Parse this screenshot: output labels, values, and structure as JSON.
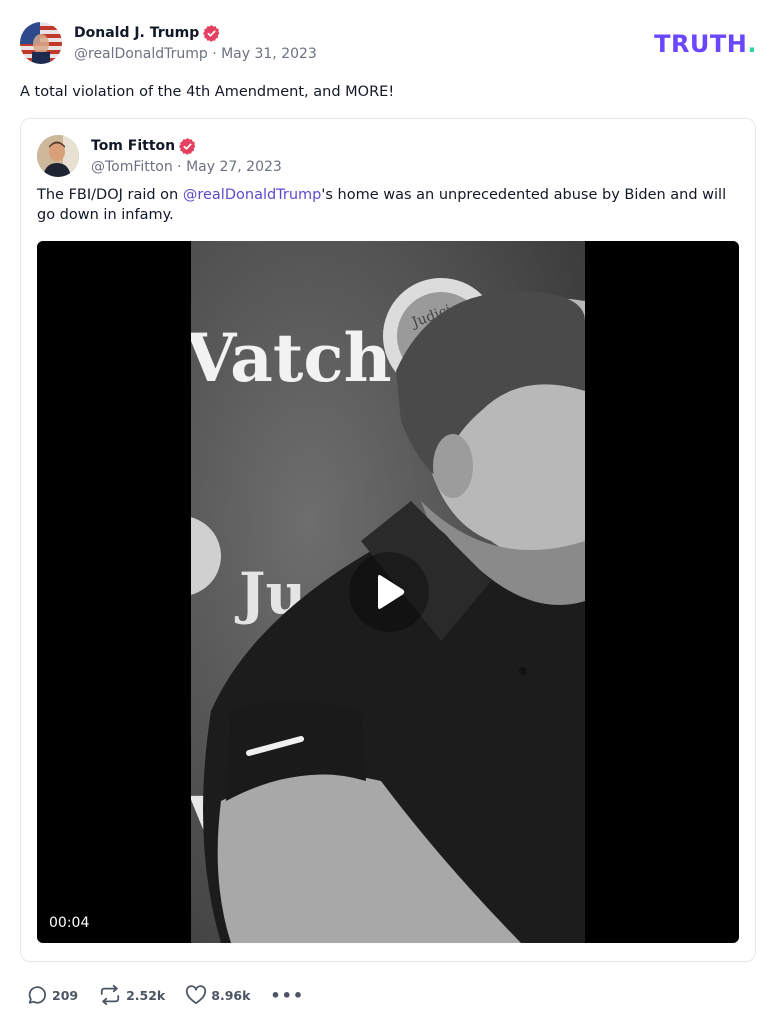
{
  "post": {
    "author_name": "Donald J. Trump",
    "handle_date": "@realDonaldTrump · May 31, 2023",
    "text": "A total violation of the 4th Amendment, and MORE!",
    "logo_main": "TRUTH",
    "logo_dot": "."
  },
  "quote": {
    "author_name": "Tom Fitton",
    "handle_date": "@TomFitton · May 27, 2023",
    "text_before": "The FBI/DOJ raid on ",
    "mention": "@realDonaldTrump",
    "text_after": "'s home was an unprecedented abuse by Biden and will go down in infamy.",
    "video": {
      "duration": "00:04",
      "frame_text_top": "Vatch",
      "frame_text_mid": "Ju",
      "frame_text_bottom": "Va",
      "seal_text": "Judici"
    }
  },
  "actions": {
    "replies": "209",
    "retruths": "2.52k",
    "likes": "8.96k",
    "more": "•••"
  },
  "colors": {
    "brand": "#6b46ff",
    "brand_dot": "#2fd4a6",
    "verified": "#e4405f",
    "mention": "#5b4bcf"
  }
}
